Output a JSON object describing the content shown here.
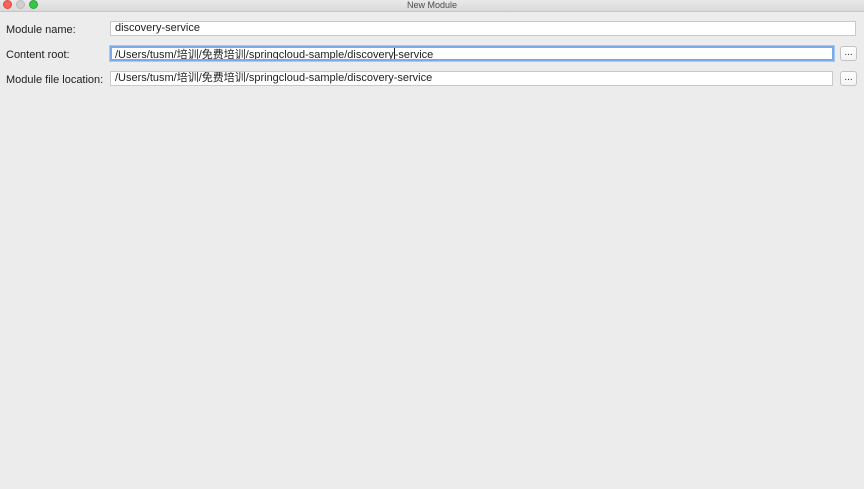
{
  "window": {
    "title": "New Module"
  },
  "form": {
    "module_name": {
      "label": "Module name:",
      "value": "discovery-service"
    },
    "content_root": {
      "label": "Content root:",
      "value_before_caret": "/Users/tusm/培训/免费培训/springcloud-sample/discovery",
      "value_after_caret": "-service",
      "browse_label": "..."
    },
    "module_file_location": {
      "label": "Module file location:",
      "value": "/Users/tusm/培训/免费培训/springcloud-sample/discovery-service",
      "browse_label": "..."
    }
  }
}
